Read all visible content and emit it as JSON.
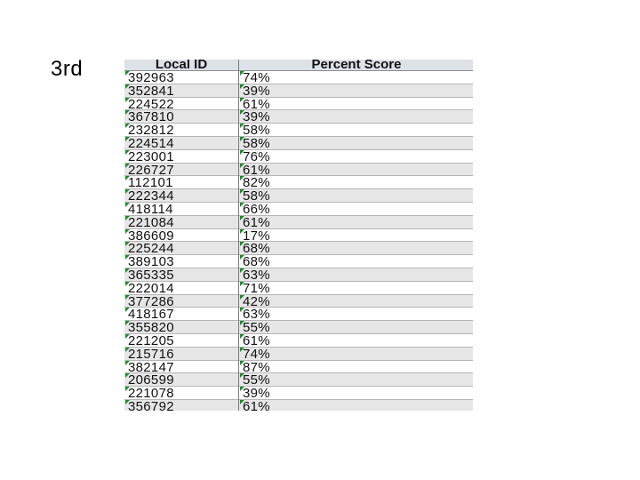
{
  "slide": {
    "label": "3rd"
  },
  "table": {
    "headers": [
      "Local ID",
      "Percent Score"
    ],
    "rows": [
      [
        "392963",
        "74%"
      ],
      [
        "352841",
        "39%"
      ],
      [
        "224522",
        "61%"
      ],
      [
        "367810",
        "39%"
      ],
      [
        "232812",
        "58%"
      ],
      [
        "224514",
        "58%"
      ],
      [
        "223001",
        "76%"
      ],
      [
        "226727",
        "61%"
      ],
      [
        "112101",
        "82%"
      ],
      [
        "222344",
        "58%"
      ],
      [
        "418114",
        "66%"
      ],
      [
        "221084",
        "61%"
      ],
      [
        "386609",
        "17%"
      ],
      [
        "225244",
        "68%"
      ],
      [
        "389103",
        "68%"
      ],
      [
        "365335",
        "63%"
      ],
      [
        "222014",
        "71%"
      ],
      [
        "377286",
        "42%"
      ],
      [
        "418167",
        "63%"
      ],
      [
        "355820",
        "55%"
      ],
      [
        "221205",
        "61%"
      ],
      [
        "215716",
        "74%"
      ],
      [
        "382147",
        "87%"
      ],
      [
        "206599",
        "55%"
      ],
      [
        "221078",
        "39%"
      ],
      [
        "356792",
        "61%"
      ]
    ]
  }
}
